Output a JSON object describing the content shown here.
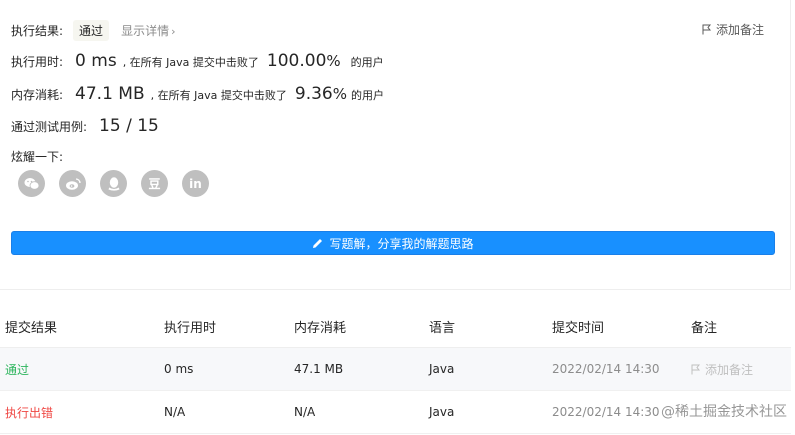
{
  "result": {
    "label": "执行结果:",
    "status": "通过",
    "detail_link": "显示详情",
    "note_button": "添加备注"
  },
  "runtime": {
    "label": "执行用时:",
    "value": "0 ms",
    "beat_text": ", 在所有 Java 提交中击败了",
    "percent": "100.00",
    "percent_unit": "%",
    "suffix": "的用户"
  },
  "memory": {
    "label": "内存消耗:",
    "value": "47.1 MB",
    "beat_text": ", 在所有 Java 提交中击败了",
    "percent": "9.36",
    "percent_unit": "%",
    "suffix": "的用户"
  },
  "tests": {
    "label": "通过测试用例:",
    "value": "15 / 15"
  },
  "share": {
    "label": "炫耀一下:",
    "icons": [
      "wechat-icon",
      "weibo-icon",
      "qq-icon",
      "douban-icon",
      "linkedin-icon"
    ],
    "douban_glyph": "豆",
    "linkedin_glyph": "in"
  },
  "solution_button": "写题解，分享我的解题思路",
  "table": {
    "headers": [
      "提交结果",
      "执行用时",
      "内存消耗",
      "语言",
      "提交时间",
      "备注"
    ],
    "rows": [
      {
        "result": "通过",
        "runtime": "0 ms",
        "memory": "47.1 MB",
        "language": "Java",
        "time": "2022/02/14 14:30",
        "note": "添加备注"
      },
      {
        "result": "执行出错",
        "runtime": "N/A",
        "memory": "N/A",
        "language": "Java",
        "time": "2022/02/14 14:30",
        "note": ""
      }
    ]
  },
  "watermark": "@稀土掘金技术社区",
  "colors": {
    "accent": "#1890ff",
    "success": "#2db55d",
    "error": "#ef4743",
    "icon_gray": "#bfbfbf"
  }
}
